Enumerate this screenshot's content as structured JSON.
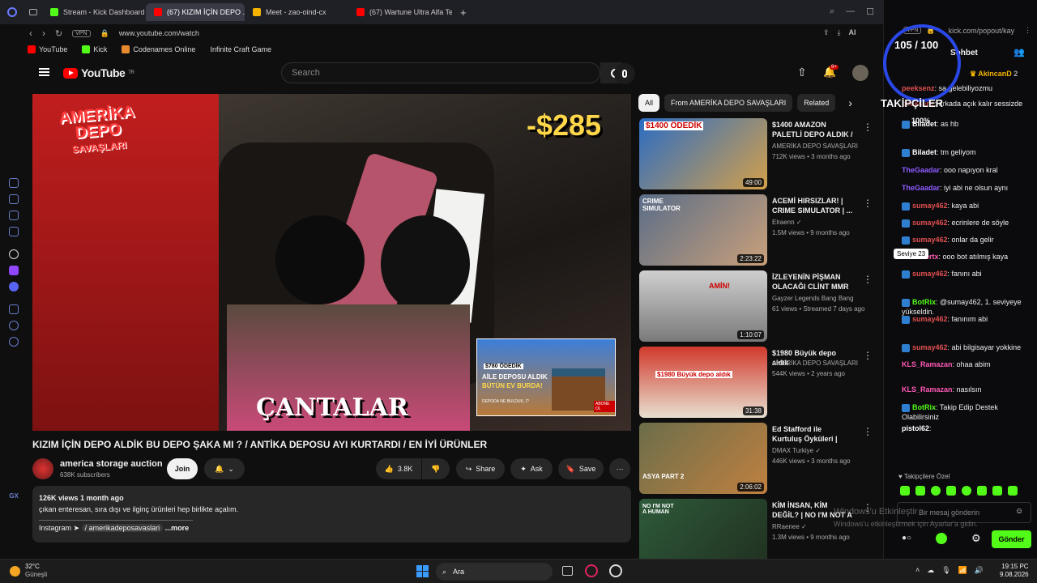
{
  "tabs": [
    {
      "label": "Stream - Kick Dashboard",
      "color": "#53fc18"
    },
    {
      "label": "(67) KIZIM İÇİN DEPO ...",
      "color": "#ff0000"
    },
    {
      "label": "Meet - zao-oind-cx",
      "color": "#f4b400"
    },
    {
      "label": "(67) Wartune Ultra Alfa Tec",
      "color": "#ff0000"
    }
  ],
  "address": {
    "vpn": "VPN",
    "url": "www.youtube.com/watch"
  },
  "bookmarks": [
    "YouTube",
    "Kick",
    "Codenames Online",
    "Infinite Craft Game"
  ],
  "youtube": {
    "logo": "YouTube",
    "logo_sup": "TR",
    "search_placeholder": "Search",
    "notif_count": "9+",
    "video": {
      "brand_line1": "AMERİKA",
      "brand_line2": "DEPO",
      "brand_line3": "SAVAŞLARI",
      "price": "-$285",
      "caption": "ÇANTALAR",
      "inset_title": "$780 ÖDEDİK",
      "inset_line1": "AİLE DEPOSU ALDIK",
      "inset_line2": "BÜTÜN EV BURDA!",
      "inset_sub": "DEPODA NE BULDUK..!?",
      "subscribe": "ABONE OL"
    },
    "title": "KIZIM İÇİN DEPO ALDİK BU DEPO ŞAKA MI ? / ANTİKA DEPOSU AYI KURTARDI / EN İYİ ÜRÜNLER",
    "channel": {
      "name": "america storage auction",
      "subs": "638K subscribers",
      "join": "Join"
    },
    "actions": {
      "likes": "3.8K",
      "share": "Share",
      "ask": "Ask",
      "save": "Save"
    },
    "description": {
      "views": "126K views",
      "date": "1 month ago",
      "text": "çıkan enteresan, sıra dışı ve ilginç ürünleri hep birlikte açalım.",
      "instagram": "Instagram ➤",
      "handle": "/ amerikadeposavaslari",
      "more": "...more"
    },
    "chips": [
      "All",
      "From AMERİKA DEPO SAVAŞLARI",
      "Related"
    ],
    "recommendations": [
      {
        "title": "$1400 AMAZON PALETLİ DEPO ALDIK / NELER ...",
        "channel": "AMERİKA DEPO SAVAŞLARI",
        "meta": "712K views • 3 months ago",
        "duration": "49:00",
        "thumb_text": "$1400 ÖDEDİK",
        "color": "#2a6cc4"
      },
      {
        "title": "ACEMİ HIRSIZLAR! | CRIME SIMULATOR | ...",
        "channel": "Elraenn",
        "meta": "1.5M views • 9 months ago",
        "duration": "2:23:22",
        "thumb_text": "CRIME SIMULATOR",
        "color": "#5a6d88"
      },
      {
        "title": "İZLEYENİN PİŞMAN OLACAĞI CLİNT MMR ...",
        "channel": "Gayzer Legends Bang Bang",
        "meta": "61 views • Streamed 7 days ago",
        "duration": "1:10:07",
        "thumb_text": "AMİN!",
        "color": "#9a9a9a"
      },
      {
        "title": "$1980 Büyük depo aldık",
        "channel": "AMERİKA DEPO SAVAŞLARI",
        "meta": "544K views • 2 years ago",
        "duration": "31:38",
        "thumb_text": "$1980 Büyük depo aldık",
        "color": "#d0392b"
      },
      {
        "title": "Ed Stafford ile Kurtuluş Öyküleri | Asya Part 2 ...",
        "channel": "DMAX Turkiye",
        "meta": "446K views • 3 months ago",
        "duration": "2:06:02",
        "thumb_text": "ASYA PART 2",
        "color": "#6b6e4a"
      },
      {
        "title": "KİM İNSAN, KİM DEĞİL? | NO I'M NOT A HUMAN ...",
        "channel": "RRaenee",
        "meta": "1.3M views • 9 months ago",
        "duration": "",
        "thumb_text": "NO I'M NOT A HUMAN",
        "color": "#2e5a3a"
      }
    ]
  },
  "chat": {
    "vpn": "VPN",
    "url": "kick.com/popout/kay",
    "header": "Sohbet",
    "follow_goal": "105 / 100",
    "follow_label": "TAKİPÇİLER",
    "follow_pct": "100%",
    "top_user": "AkincanD",
    "top_rank": "2",
    "messages": [
      {
        "user": "peeksenz",
        "text": ": sa gelebiliyozmu",
        "color": "#e05050",
        "badge": false
      },
      {
        "user": "peeksenz",
        "text": ": arkada açık kalır sessizde",
        "color": "#e05050",
        "badge": false
      },
      {
        "user": "Biladet",
        "text": ": as hb",
        "color": "#ffffff",
        "badge": true
      },
      {
        "user": "Biladet",
        "text": ": tm geliyom",
        "color": "#ffffff",
        "badge": true
      },
      {
        "user": "TheGaadar",
        "text": ": ooo napıyon kral",
        "color": "#8f5cff",
        "badge": false
      },
      {
        "user": "TheGaadar",
        "text": ": iyi abi ne olsun aynı",
        "color": "#8f5cff",
        "badge": false
      },
      {
        "user": "sumay462",
        "text": ": kaya abi",
        "color": "#e05050",
        "badge": true
      },
      {
        "user": "sumay462",
        "text": ": ecrinlere de söyle",
        "color": "#e05050",
        "badge": true
      },
      {
        "user": "sumay462",
        "text": ": onlar da gelir",
        "color": "#e05050",
        "badge": true
      },
      {
        "user": "xkralmertx",
        "text": ": ooo bot atılmış kaya",
        "color": "#ff5ab4",
        "badge": false
      },
      {
        "user": "sumay462",
        "text": ": fanını abi",
        "color": "#e05050",
        "badge": true
      },
      {
        "user": "BotRix",
        "text": ": @sumay462, 1. seviyeye yükseldin.",
        "color": "#53fc18",
        "badge": true
      },
      {
        "user": "sumay462",
        "text": ": fanınım abi",
        "color": "#e05050",
        "badge": true
      },
      {
        "user": "sumay462",
        "text": ": abi bilgisayar yokkine",
        "color": "#e05050",
        "badge": true
      },
      {
        "user": "KLS_Ramazan",
        "text": ": ohaa abim",
        "color": "#ff5ab4",
        "badge": false
      },
      {
        "user": "KLS_Ramazan",
        "text": ": nasılsın",
        "color": "#ff5ab4",
        "badge": false
      },
      {
        "user": "BotRix",
        "text": ": Takip Edip Destek Olabilirsiniz",
        "color": "#53fc18",
        "badge": true
      },
      {
        "user": "pistol62",
        "text": ":",
        "color": "#ffffff",
        "badge": false
      }
    ],
    "tooltip": "Seviye 23",
    "follower_special": "Takipçilere Özel",
    "input_placeholder": "Bir mesaj gönderin",
    "send": "Gönder",
    "watermark1": "Windows'u Etkinleştir",
    "watermark2": "Windows'u etkinleştirmek için Ayarlar'a gidin."
  },
  "taskbar": {
    "temp": "32°C",
    "weather": "Güneşli",
    "search": "Ara",
    "time": "19:15",
    "date": "9.08.2026",
    "lang": "PC"
  }
}
